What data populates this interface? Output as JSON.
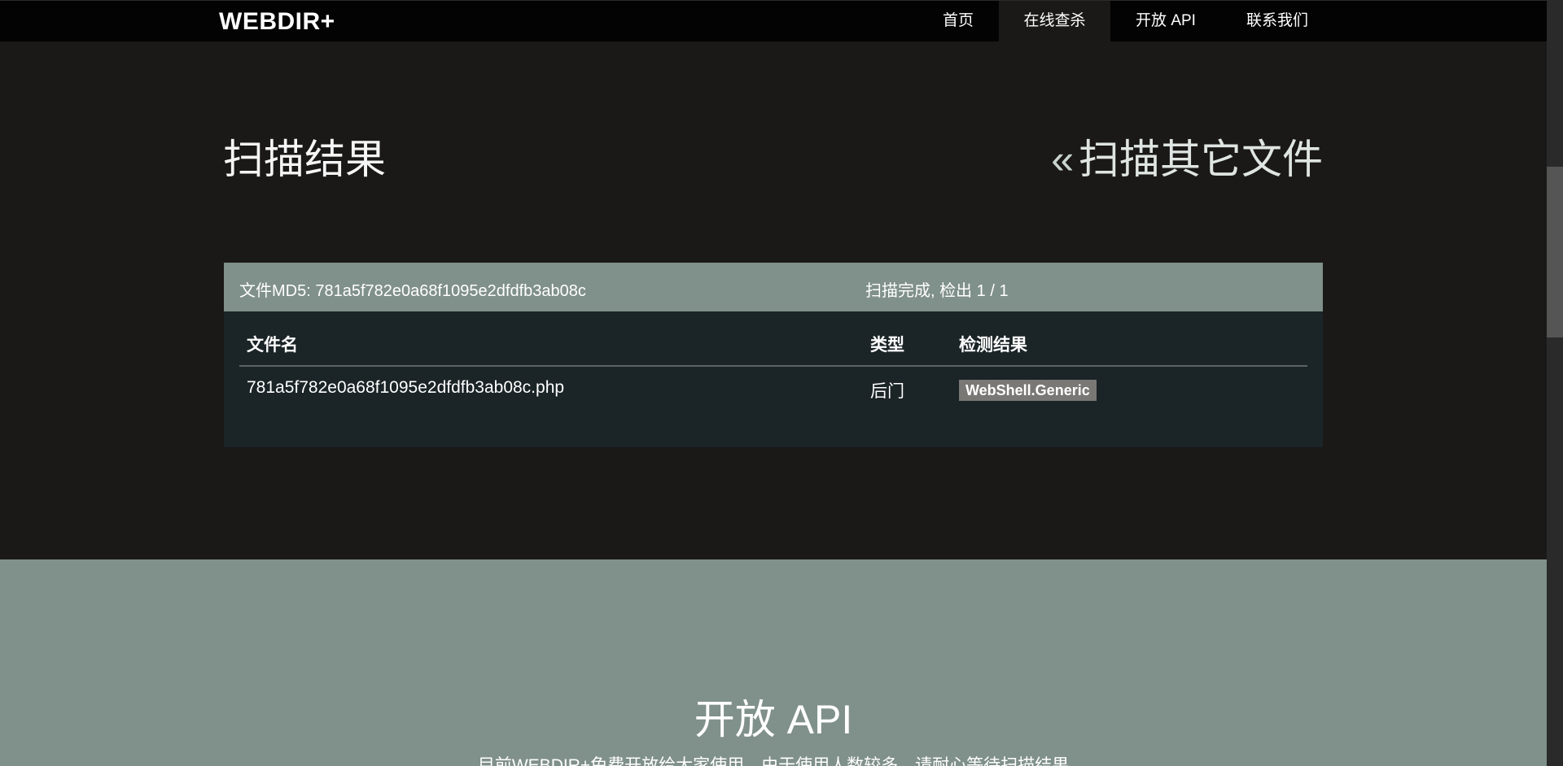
{
  "navbar": {
    "brand": "WEBDIR+",
    "items": [
      {
        "label": "首页"
      },
      {
        "label": "在线查杀"
      },
      {
        "label": "开放 API"
      },
      {
        "label": "联系我们"
      }
    ],
    "active_item": "在线查杀"
  },
  "header": {
    "title": "扫描结果",
    "scan_other_icon": "«",
    "scan_other_label": "扫描其它文件"
  },
  "results": {
    "md5_label": "文件MD5: 781a5f782e0a68f1095e2dfdfb3ab08c",
    "status_label": "扫描完成, 检出 1 / 1",
    "columns": [
      "文件名",
      "类型",
      "检测结果"
    ],
    "rows": [
      {
        "filename": "781a5f782e0a68f1095e2dfdfb3ab08c.php",
        "type": "后门",
        "result": "WebShell.Generic"
      }
    ]
  },
  "api_section": {
    "title": "开放 API",
    "description": "目前WEBDIR+免费开放给大家使用，由于使用人数较多，请耐心等待扫描结果"
  },
  "colors": {
    "navbar_bg": "#030303",
    "page_bg": "#1a1918",
    "panel_head_bg": "#80908b",
    "panel_body_bg": "#1b2427",
    "tag_bg": "#7a7874"
  }
}
